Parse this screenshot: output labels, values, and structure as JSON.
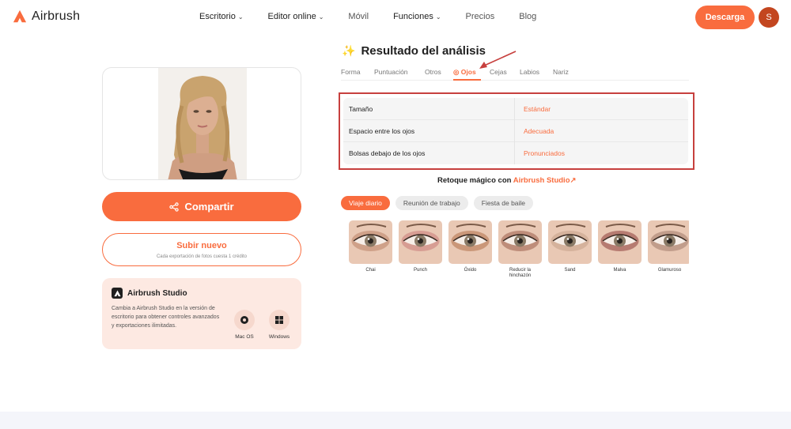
{
  "header": {
    "logo_text": "Airbrush",
    "nav": [
      {
        "label": "Escritorio",
        "dropdown": true
      },
      {
        "label": "Editor online",
        "dropdown": true
      },
      {
        "label": "Móvil",
        "dropdown": false
      },
      {
        "label": "Funciones",
        "dropdown": true
      },
      {
        "label": "Precios",
        "dropdown": false
      },
      {
        "label": "Blog",
        "dropdown": false
      }
    ],
    "download_label": "Descarga",
    "avatar_initial": "S"
  },
  "left": {
    "share_label": "Compartir",
    "upload_title": "Subir nuevo",
    "upload_subtitle": "Cada exportación de fotos cuesta 1 crédito",
    "studio": {
      "title": "Airbrush Studio",
      "description": "Cambia a Airbrush Studio en la versión de escritorio para obtener controles avanzados y exportaciones ilimitadas.",
      "mac_label": "Mac OS",
      "windows_label": "Windows"
    }
  },
  "result": {
    "title": "Resultado del análisis",
    "tabs": [
      "Forma",
      "Puntuación",
      "Otros",
      "Ojos",
      "Cejas",
      "Labios",
      "Nariz"
    ],
    "active_tab": "Ojos",
    "rows": [
      {
        "label": "Tamaño",
        "value": "Estándar"
      },
      {
        "label": "Espacio entre los ojos",
        "value": "Adecuada"
      },
      {
        "label": "Bolsas debajo de los ojos",
        "value": "Pronunciados"
      }
    ],
    "magic_prefix": "Retoque mágico con ",
    "magic_link": "Airbrush Studio↗",
    "chips": [
      "Viaje diario",
      "Reunión de trabajo",
      "Fiesta de baile"
    ],
    "active_chip": "Viaje diario",
    "looks": [
      {
        "label": "Chai",
        "shadow": "#b98266"
      },
      {
        "label": "Punch",
        "shadow": "#c97a78"
      },
      {
        "label": "Óxido",
        "shadow": "#b07048"
      },
      {
        "label": "Reducir la hinchazón",
        "shadow": "#9b5d4a"
      },
      {
        "label": "Sand",
        "shadow": "#c4a088"
      },
      {
        "label": "Malva",
        "shadow": "#8c3d3a"
      },
      {
        "label": "Glamuroso",
        "shadow": "#a07a6a"
      }
    ]
  },
  "colors": {
    "accent": "#f96c3e",
    "highlight_box": "#c7403e",
    "studio_bg": "#fde9e2"
  }
}
